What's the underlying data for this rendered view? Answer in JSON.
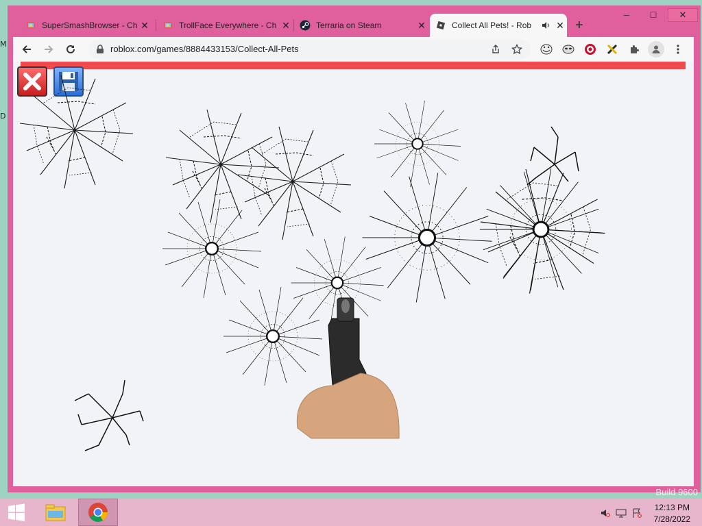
{
  "desktop": {
    "left_glyph_1": "M",
    "left_glyph_2": "D",
    "watermark": "Build 9600"
  },
  "browser": {
    "tabs": [
      {
        "title": "SuperSmashBrowser - Ch",
        "icon": "colorful-favicon-icon",
        "active": false
      },
      {
        "title": "TrollFace Everywhere - Ch",
        "icon": "colorful-favicon-icon",
        "active": false
      },
      {
        "title": "Terraria on Steam",
        "icon": "steam-icon",
        "active": false
      },
      {
        "title": "Collect All Pets! - Rob",
        "icon": "roblox-icon",
        "active": true
      }
    ],
    "new_tab_label": "+",
    "url": "roblox.com/games/8884433153/Collect-All-Pets",
    "window_controls": {
      "minimize": "─",
      "maximize": "☐",
      "close": "✕"
    },
    "colors": {
      "frame": "#e0609e",
      "content_bg": "#f1f3f6",
      "redbar": "#f14a4e"
    }
  },
  "page": {
    "overlay_buttons": [
      {
        "name": "close",
        "icon": "red-x-icon"
      },
      {
        "name": "save",
        "icon": "floppy-disk-icon"
      }
    ]
  },
  "taskbar": {
    "time": "12:13 PM",
    "date": "7/28/2022",
    "apps": [
      "start-icon",
      "file-explorer-icon",
      "chrome-icon"
    ]
  }
}
